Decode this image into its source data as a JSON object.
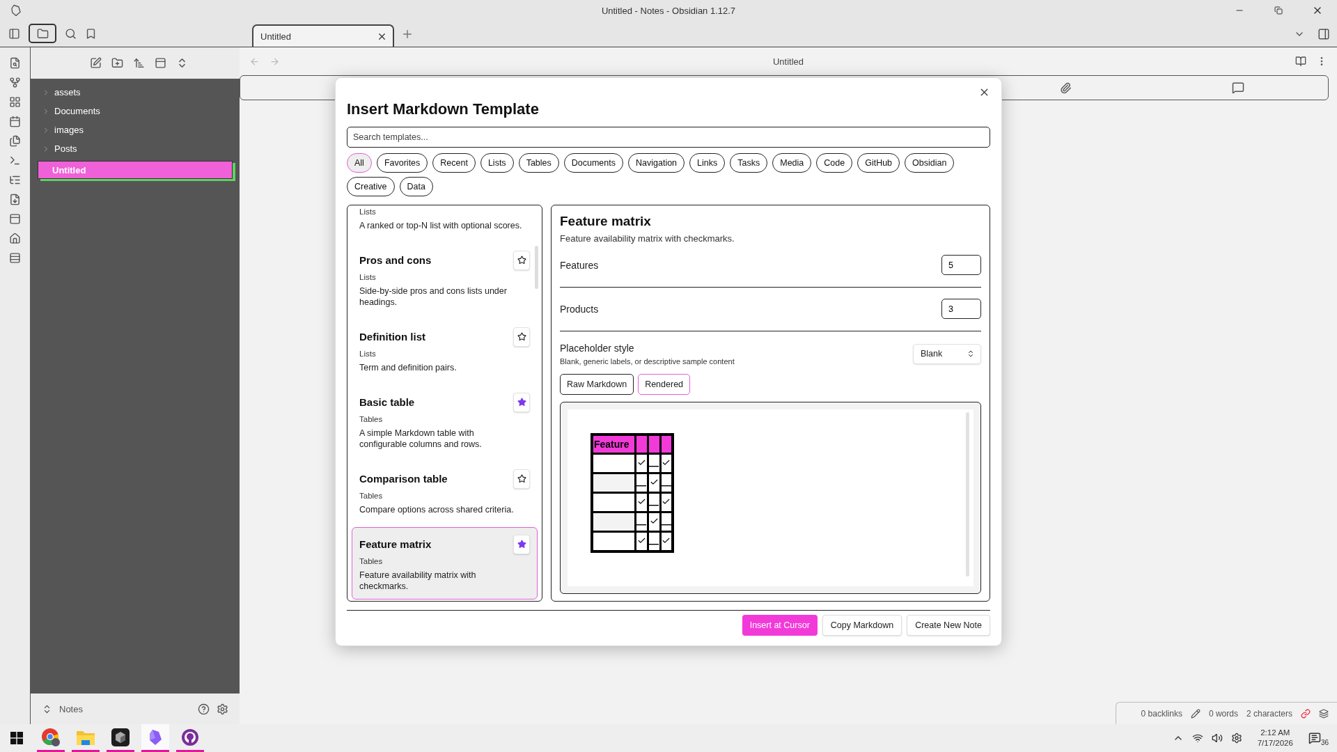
{
  "window": {
    "title": "Untitled - Notes - Obsidian 1.12.7"
  },
  "tabs": [
    {
      "label": "Untitled",
      "selected": true
    }
  ],
  "file_tree": [
    {
      "label": "assets",
      "kind": "folder",
      "selected": false
    },
    {
      "label": "Documents",
      "kind": "folder",
      "selected": false
    },
    {
      "label": "images",
      "kind": "folder",
      "selected": false
    },
    {
      "label": "Posts",
      "kind": "folder",
      "selected": false
    },
    {
      "label": "Untitled",
      "kind": "file",
      "selected": true
    }
  ],
  "vault": {
    "name": "Notes"
  },
  "editor": {
    "title": "Untitled"
  },
  "modal": {
    "title": "Insert Markdown Template",
    "search": {
      "placeholder": "Search templates..."
    },
    "filters": [
      {
        "label": "All",
        "selected": true
      },
      {
        "label": "Favorites",
        "selected": false
      },
      {
        "label": "Recent",
        "selected": false
      },
      {
        "label": "Lists",
        "selected": false
      },
      {
        "label": "Tables",
        "selected": false
      },
      {
        "label": "Documents",
        "selected": false
      },
      {
        "label": "Navigation",
        "selected": false
      },
      {
        "label": "Links",
        "selected": false
      },
      {
        "label": "Tasks",
        "selected": false
      },
      {
        "label": "Media",
        "selected": false
      },
      {
        "label": "Code",
        "selected": false
      },
      {
        "label": "GitHub",
        "selected": false
      },
      {
        "label": "Obsidian",
        "selected": false
      },
      {
        "label": "Creative",
        "selected": false
      },
      {
        "label": "Data",
        "selected": false
      }
    ],
    "templates": [
      {
        "category": "Lists",
        "description": "A ranked or top-N list with optional scores.",
        "selected": false
      },
      {
        "name": "Pros and cons",
        "category": "Lists",
        "description": "Side-by-side pros and cons lists under headings.",
        "favorite": false,
        "selected": false
      },
      {
        "name": "Definition list",
        "category": "Lists",
        "description": "Term and definition pairs.",
        "favorite": false,
        "selected": false
      },
      {
        "name": "Basic table",
        "category": "Tables",
        "description": "A simple Markdown table with configurable columns and rows.",
        "favorite": true,
        "selected": false
      },
      {
        "name": "Comparison table",
        "category": "Tables",
        "description": "Compare options across shared criteria.",
        "favorite": false,
        "selected": false
      },
      {
        "name": "Feature matrix",
        "category": "Tables",
        "description": "Feature availability matrix with checkmarks.",
        "favorite": true,
        "selected": true
      }
    ],
    "detail": {
      "title": "Feature matrix",
      "description": "Feature availability matrix with checkmarks.",
      "fields": [
        {
          "label": "Features",
          "value": "5"
        },
        {
          "label": "Products",
          "value": "3"
        }
      ],
      "select": {
        "label": "Placeholder style",
        "hint": "Blank, generic labels, or descriptive sample content",
        "value": "Blank"
      },
      "view_toggle": [
        {
          "label": "Raw Markdown",
          "selected": false
        },
        {
          "label": "Rendered",
          "selected": true
        }
      ],
      "preview": {
        "header": "Feature",
        "rows": [
          {
            "checked": [
              true,
              false,
              true
            ]
          },
          {
            "checked": [
              false,
              true,
              false
            ]
          },
          {
            "checked": [
              true,
              false,
              true
            ]
          },
          {
            "checked": [
              false,
              true,
              false
            ]
          },
          {
            "checked": [
              true,
              false,
              true
            ]
          }
        ]
      }
    },
    "buttons": [
      {
        "label": "Insert at Cursor",
        "primary": true
      },
      {
        "label": "Copy Markdown",
        "primary": false
      },
      {
        "label": "Create New Note",
        "primary": false
      }
    ]
  },
  "status_bar": {
    "backlinks": "0 backlinks",
    "words": "0 words",
    "characters": "2 characters"
  },
  "taskbar": {
    "apps": [
      {
        "kind": "browser",
        "active": false
      },
      {
        "kind": "files",
        "active": false
      },
      {
        "kind": "cube",
        "active": false
      },
      {
        "kind": "gem",
        "active": true
      },
      {
        "kind": "github",
        "active": false
      }
    ],
    "time": "2:12 AM",
    "date": "7/17/2026",
    "notifications": "36"
  }
}
